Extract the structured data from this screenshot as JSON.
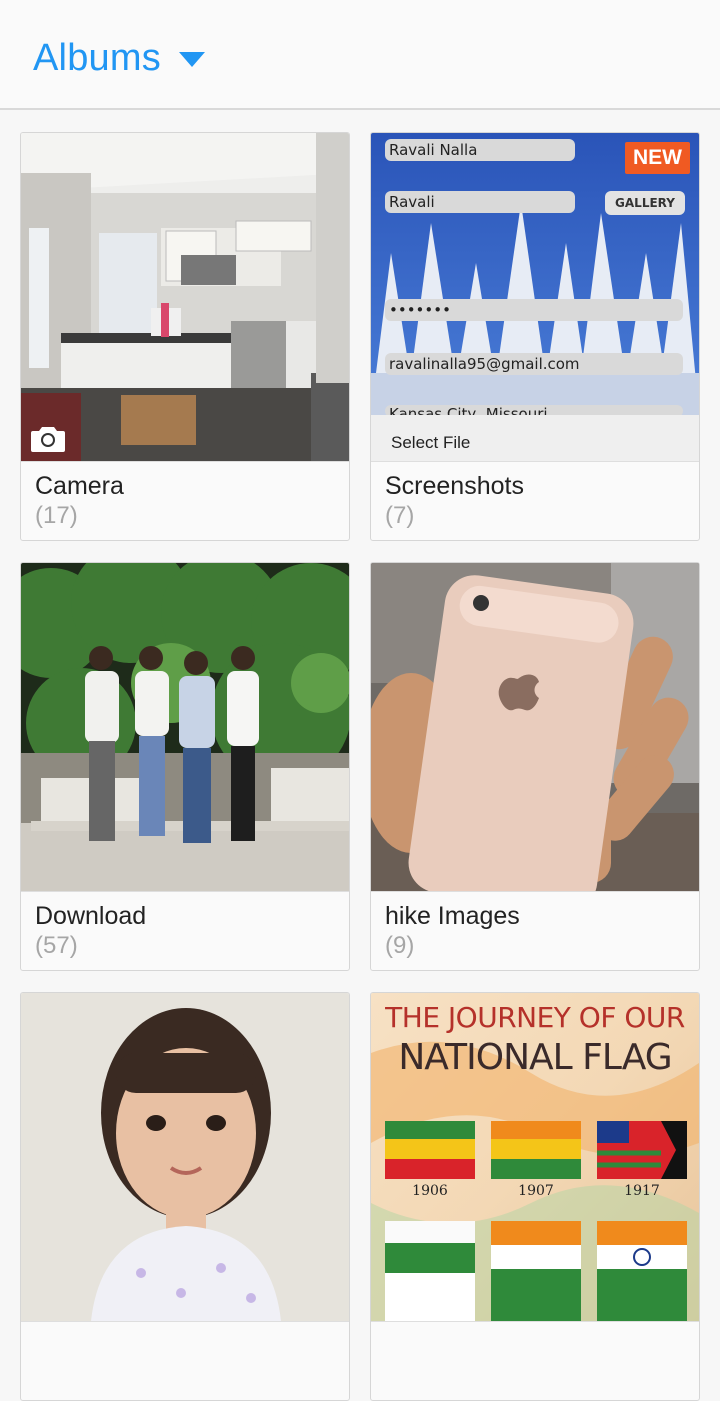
{
  "header": {
    "title": "Albums"
  },
  "albums": [
    {
      "name": "Camera",
      "count": "(17)"
    },
    {
      "name": "Screenshots",
      "count": "(7)",
      "badge": "NEW",
      "preview": {
        "field1": "Ravali Nalla",
        "field2": "Ravali",
        "button": "GALLERY",
        "field3": "•••••••",
        "field4": "ravalinalla95@gmail.com",
        "field5": "Kansas City, Missouri",
        "bottom": "Select File"
      }
    },
    {
      "name": "Download",
      "count": "(57)"
    },
    {
      "name": "hike Images",
      "count": "(9)"
    },
    {
      "name": "",
      "count": ""
    },
    {
      "name": "",
      "count": "",
      "preview": {
        "line1": "THE JOURNEY OF OUR",
        "line2": "NATIONAL FLAG",
        "years": [
          "1906",
          "1907",
          "1917"
        ]
      }
    }
  ],
  "colors": {
    "accent": "#2196f3",
    "badge": "#f05a22"
  },
  "icons": {
    "dropdown": "caret-down-icon",
    "camera": "camera-icon"
  }
}
